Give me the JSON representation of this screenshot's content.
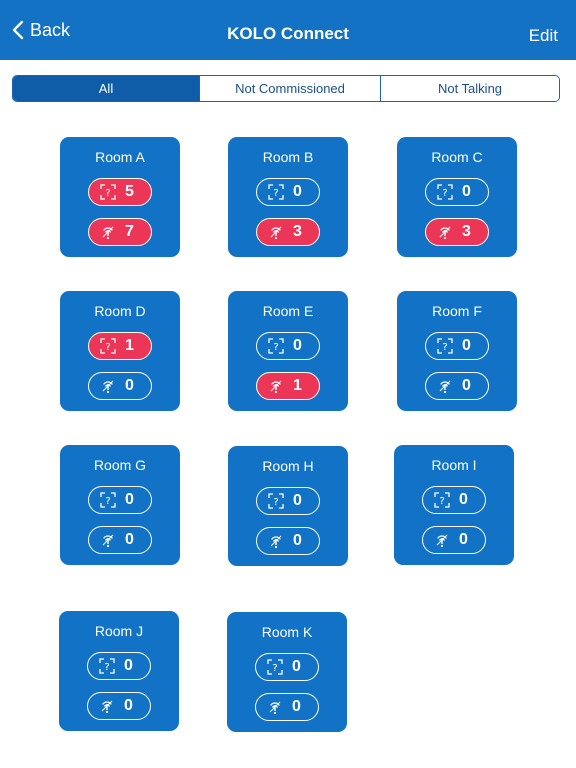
{
  "nav": {
    "back_label": "Back",
    "title": "KOLO Connect",
    "edit_label": "Edit"
  },
  "tabs": [
    {
      "label": "All",
      "active": true
    },
    {
      "label": "Not Commissioned",
      "active": false
    },
    {
      "label": "Not Talking",
      "active": false
    }
  ],
  "icons": {
    "not_commissioned": "unknown-device-icon",
    "not_talking": "signal-lost-icon"
  },
  "colors": {
    "brand_blue": "#1273c6",
    "alert_red": "#ec3657"
  },
  "rooms": [
    {
      "name": "Room A",
      "not_commissioned": 5,
      "not_talking": 7
    },
    {
      "name": "Room B",
      "not_commissioned": 0,
      "not_talking": 3
    },
    {
      "name": "Room C",
      "not_commissioned": 0,
      "not_talking": 3
    },
    {
      "name": "Room D",
      "not_commissioned": 1,
      "not_talking": 0
    },
    {
      "name": "Room E",
      "not_commissioned": 0,
      "not_talking": 1
    },
    {
      "name": "Room F",
      "not_commissioned": 0,
      "not_talking": 0
    },
    {
      "name": "Room G",
      "not_commissioned": 0,
      "not_talking": 0
    },
    {
      "name": "Room H",
      "not_commissioned": 0,
      "not_talking": 0
    },
    {
      "name": "Room I",
      "not_commissioned": 0,
      "not_talking": 0
    },
    {
      "name": "Room J",
      "not_commissioned": 0,
      "not_talking": 0
    },
    {
      "name": "Room K",
      "not_commissioned": 0,
      "not_talking": 0
    }
  ]
}
